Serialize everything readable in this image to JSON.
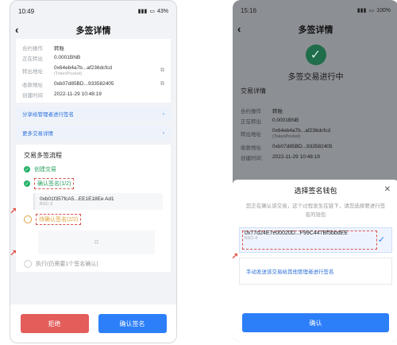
{
  "left": {
    "status": {
      "time": "10:49",
      "battery": "43%"
    },
    "title": "多签详情",
    "details": [
      {
        "k": "合约操作",
        "v": "转账"
      },
      {
        "k": "正在转出",
        "v": "0.0001BNB"
      },
      {
        "k": "转出地址",
        "v": "0x64eb4a7b...af236dcfcd",
        "sub": "(TokenPocket)"
      },
      {
        "k": "收款地址",
        "v": "0xb07d85BD...933582405"
      },
      {
        "k": "创建时间",
        "v": "2022-11-29 10:48:19"
      }
    ],
    "links": {
      "share": "分享给管理者进行签名",
      "more": "更多交易详情"
    },
    "flow_title": "交易多签流程",
    "steps": {
      "create": "创建交易",
      "confirm": "确认签名(1/2)",
      "pending": "待确认签名(2/2)",
      "execute": "执行(仍需要1个签名确认)"
    },
    "signer": {
      "addr": "0xb01f357fcA5...EE1E18Ee Ad1",
      "chain": "BSC-3"
    },
    "buttons": {
      "reject": "拒绝",
      "confirm": "确认签名"
    }
  },
  "right": {
    "status": {
      "time": "15:16",
      "battery": "100%"
    },
    "title": "多签详情",
    "success": "多签交易进行中",
    "section": "交易详情",
    "details": [
      {
        "k": "合约操作",
        "v": "转账"
      },
      {
        "k": "正在转出",
        "v": "0.0001BNB"
      },
      {
        "k": "转出地址",
        "v": "0x64eb4a7b...af236dcfcd",
        "sub": "(TokenPocket)"
      },
      {
        "k": "收款地址",
        "v": "0xb07d85BD...933582405"
      },
      {
        "k": "创建时间",
        "v": "2022-11-29 10:48:19"
      }
    ],
    "sheet": {
      "title": "选择签名钱包",
      "desc": "您正在确认该交易，这个过程发生在链下，请您选择要进行签名的钱包",
      "wallet_addr": "0x77d24E7e00020D...F99C447Bf5bbdEE",
      "wallet_chain": "BSC-4",
      "manual": "手动发送该交易给其他管理者进行签名",
      "confirm": "确认"
    }
  }
}
